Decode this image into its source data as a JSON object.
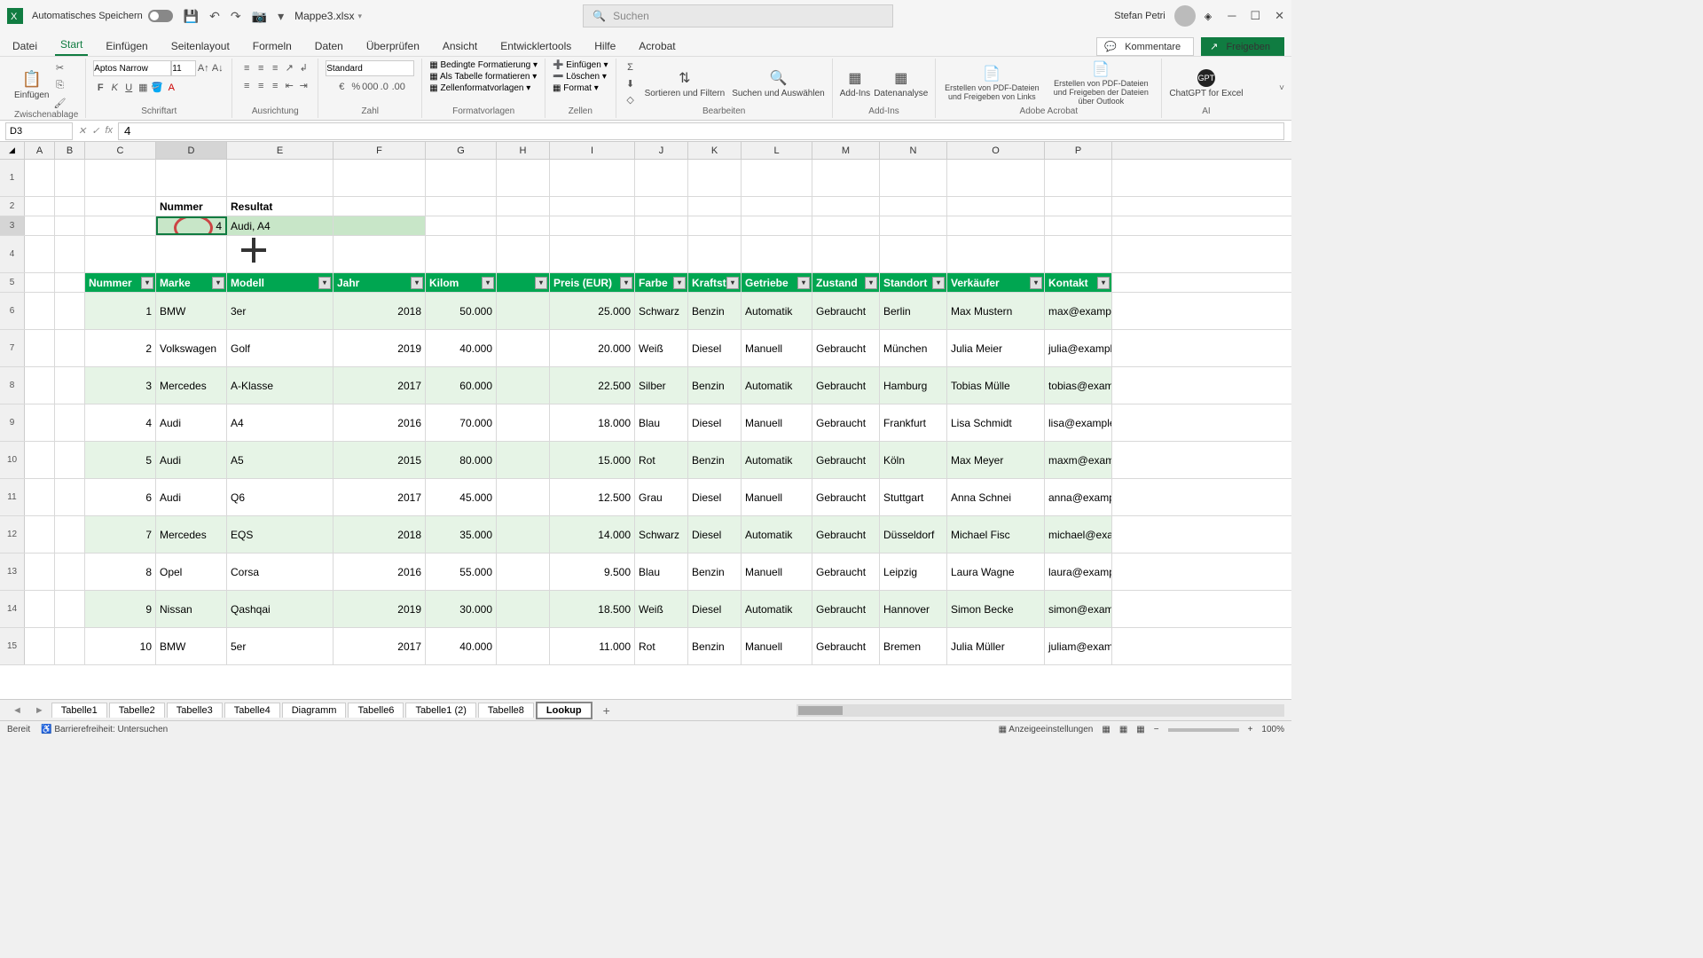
{
  "titlebar": {
    "autosave_label": "Automatisches Speichern",
    "filename": "Mappe3.xlsx",
    "search_placeholder": "Suchen",
    "username": "Stefan Petri"
  },
  "menutabs": {
    "items": [
      "Datei",
      "Start",
      "Einfügen",
      "Seitenlayout",
      "Formeln",
      "Daten",
      "Überprüfen",
      "Ansicht",
      "Entwicklertools",
      "Hilfe",
      "Acrobat"
    ],
    "comment_btn": "Kommentare",
    "share_btn": "Freigeben"
  },
  "ribbon": {
    "clipboard": {
      "label": "Zwischenablage",
      "paste": "Einfügen"
    },
    "font": {
      "label": "Schriftart",
      "name": "Aptos Narrow",
      "size": "11"
    },
    "align": {
      "label": "Ausrichtung"
    },
    "number": {
      "label": "Zahl",
      "format": "Standard"
    },
    "styles": {
      "label": "Formatvorlagen",
      "cond": "Bedingte Formatierung",
      "table": "Als Tabelle formatieren",
      "cell": "Zellenformatvorlagen"
    },
    "cells": {
      "label": "Zellen",
      "insert": "Einfügen",
      "delete": "Löschen",
      "format": "Format"
    },
    "editing": {
      "label": "Bearbeiten",
      "sort": "Sortieren und Filtern",
      "find": "Suchen und Auswählen"
    },
    "addins": {
      "label": "Add-Ins",
      "addins_btn": "Add-Ins",
      "analysis": "Datenanalyse"
    },
    "acrobat": {
      "label": "Adobe Acrobat",
      "pdf1": "Erstellen von PDF-Dateien und Freigeben von Links",
      "pdf2": "Erstellen von PDF-Dateien und Freigeben der Dateien über Outlook"
    },
    "ai": {
      "label": "AI",
      "gpt": "ChatGPT for Excel"
    }
  },
  "namebox": "D3",
  "formula": "4",
  "columns": [
    "A",
    "B",
    "C",
    "D",
    "E",
    "F",
    "G",
    "H",
    "I",
    "J",
    "K",
    "L",
    "M",
    "N",
    "O",
    "P"
  ],
  "lookup": {
    "h_nummer": "Nummer",
    "h_resultat": "Resultat",
    "nummer": "4",
    "resultat": "Audi, A4"
  },
  "table": {
    "headers": [
      "Nummer",
      "Marke",
      "Modell",
      "Jahr",
      "Kilom",
      "Preis (EUR)",
      "Farbe",
      "Kraftst",
      "Getriebe",
      "Zustand",
      "Standort",
      "Verkäufer",
      "Kontakt"
    ],
    "rows": [
      {
        "n": "1",
        "marke": "BMW",
        "modell": "3er",
        "jahr": "2018",
        "km": "50.000",
        "preis": "25.000",
        "farbe": "Schwarz",
        "kraft": "Benzin",
        "getriebe": "Automatik",
        "zustand": "Gebraucht",
        "standort": "Berlin",
        "verk": "Max Mustern",
        "kontakt": "max@example.com"
      },
      {
        "n": "2",
        "marke": "Volkswagen",
        "modell": "Golf",
        "jahr": "2019",
        "km": "40.000",
        "preis": "20.000",
        "farbe": "Weiß",
        "kraft": "Diesel",
        "getriebe": "Manuell",
        "zustand": "Gebraucht",
        "standort": "München",
        "verk": "Julia Meier",
        "kontakt": "julia@example.com"
      },
      {
        "n": "3",
        "marke": "Mercedes",
        "modell": "A-Klasse",
        "jahr": "2017",
        "km": "60.000",
        "preis": "22.500",
        "farbe": "Silber",
        "kraft": "Benzin",
        "getriebe": "Automatik",
        "zustand": "Gebraucht",
        "standort": "Hamburg",
        "verk": "Tobias Mülle",
        "kontakt": "tobias@example.com"
      },
      {
        "n": "4",
        "marke": "Audi",
        "modell": "A4",
        "jahr": "2016",
        "km": "70.000",
        "preis": "18.000",
        "farbe": "Blau",
        "kraft": "Diesel",
        "getriebe": "Manuell",
        "zustand": "Gebraucht",
        "standort": "Frankfurt",
        "verk": "Lisa Schmidt",
        "kontakt": "lisa@example.com"
      },
      {
        "n": "5",
        "marke": "Audi",
        "modell": "A5",
        "jahr": "2015",
        "km": "80.000",
        "preis": "15.000",
        "farbe": "Rot",
        "kraft": "Benzin",
        "getriebe": "Automatik",
        "zustand": "Gebraucht",
        "standort": "Köln",
        "verk": "Max Meyer",
        "kontakt": "maxm@example.com"
      },
      {
        "n": "6",
        "marke": "Audi",
        "modell": "Q6",
        "jahr": "2017",
        "km": "45.000",
        "preis": "12.500",
        "farbe": "Grau",
        "kraft": "Diesel",
        "getriebe": "Manuell",
        "zustand": "Gebraucht",
        "standort": "Stuttgart",
        "verk": "Anna Schnei",
        "kontakt": "anna@example.com"
      },
      {
        "n": "7",
        "marke": "Mercedes",
        "modell": "EQS",
        "jahr": "2018",
        "km": "35.000",
        "preis": "14.000",
        "farbe": "Schwarz",
        "kraft": "Diesel",
        "getriebe": "Automatik",
        "zustand": "Gebraucht",
        "standort": "Düsseldorf",
        "verk": "Michael Fisc",
        "kontakt": "michael@example.com"
      },
      {
        "n": "8",
        "marke": "Opel",
        "modell": "Corsa",
        "jahr": "2016",
        "km": "55.000",
        "preis": "9.500",
        "farbe": "Blau",
        "kraft": "Benzin",
        "getriebe": "Manuell",
        "zustand": "Gebraucht",
        "standort": "Leipzig",
        "verk": "Laura Wagne",
        "kontakt": "laura@example.com"
      },
      {
        "n": "9",
        "marke": "Nissan",
        "modell": "Qashqai",
        "jahr": "2019",
        "km": "30.000",
        "preis": "18.500",
        "farbe": "Weiß",
        "kraft": "Diesel",
        "getriebe": "Automatik",
        "zustand": "Gebraucht",
        "standort": "Hannover",
        "verk": "Simon Becke",
        "kontakt": "simon@example.com"
      },
      {
        "n": "10",
        "marke": "BMW",
        "modell": "5er",
        "jahr": "2017",
        "km": "40.000",
        "preis": "11.000",
        "farbe": "Rot",
        "kraft": "Benzin",
        "getriebe": "Manuell",
        "zustand": "Gebraucht",
        "standort": "Bremen",
        "verk": "Julia Müller",
        "kontakt": "juliam@example.com"
      }
    ]
  },
  "sheettabs": [
    "Tabelle1",
    "Tabelle2",
    "Tabelle3",
    "Tabelle4",
    "Diagramm",
    "Tabelle6",
    "Tabelle1 (2)",
    "Tabelle8",
    "Lookup"
  ],
  "status": {
    "ready": "Bereit",
    "access": "Barrierefreiheit: Untersuchen",
    "display": "Anzeigeeinstellungen",
    "zoom": "100%"
  }
}
